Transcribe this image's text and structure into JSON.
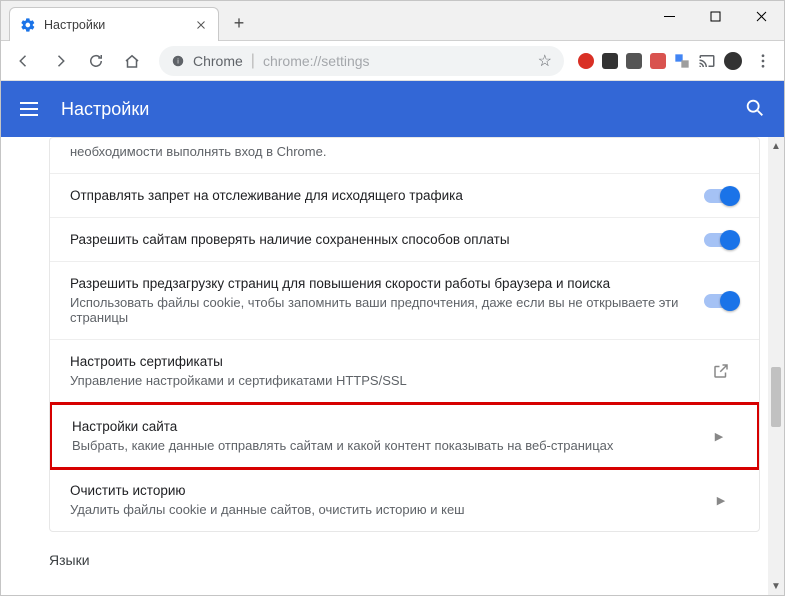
{
  "browser_tab": {
    "title": "Настройки"
  },
  "omnibox": {
    "scheme_label": "Chrome",
    "url_path": "chrome://settings"
  },
  "header": {
    "title": "Настройки"
  },
  "partial_top_text": "необходимости выполнять вход в Chrome.",
  "rows": {
    "dnt": {
      "title": "Отправлять запрет на отслеживание для исходящего трафика"
    },
    "payments": {
      "title": "Разрешить сайтам проверять наличие сохраненных способов оплаты"
    },
    "preload": {
      "title": "Разрешить предзагрузку страниц для повышения скорости работы браузера и поиска",
      "sub": "Использовать файлы cookie, чтобы запомнить ваши предпочтения, даже если вы не открываете эти страницы"
    },
    "certs": {
      "title": "Настроить сертификаты",
      "sub": "Управление настройками и сертификатами HTTPS/SSL"
    },
    "site": {
      "title": "Настройки сайта",
      "sub": "Выбрать, какие данные отправлять сайтам и какой контент показывать на веб-страницах"
    },
    "clear": {
      "title": "Очистить историю",
      "sub": "Удалить файлы cookie и данные сайтов, очистить историю и кеш"
    }
  },
  "languages_section": "Языки"
}
